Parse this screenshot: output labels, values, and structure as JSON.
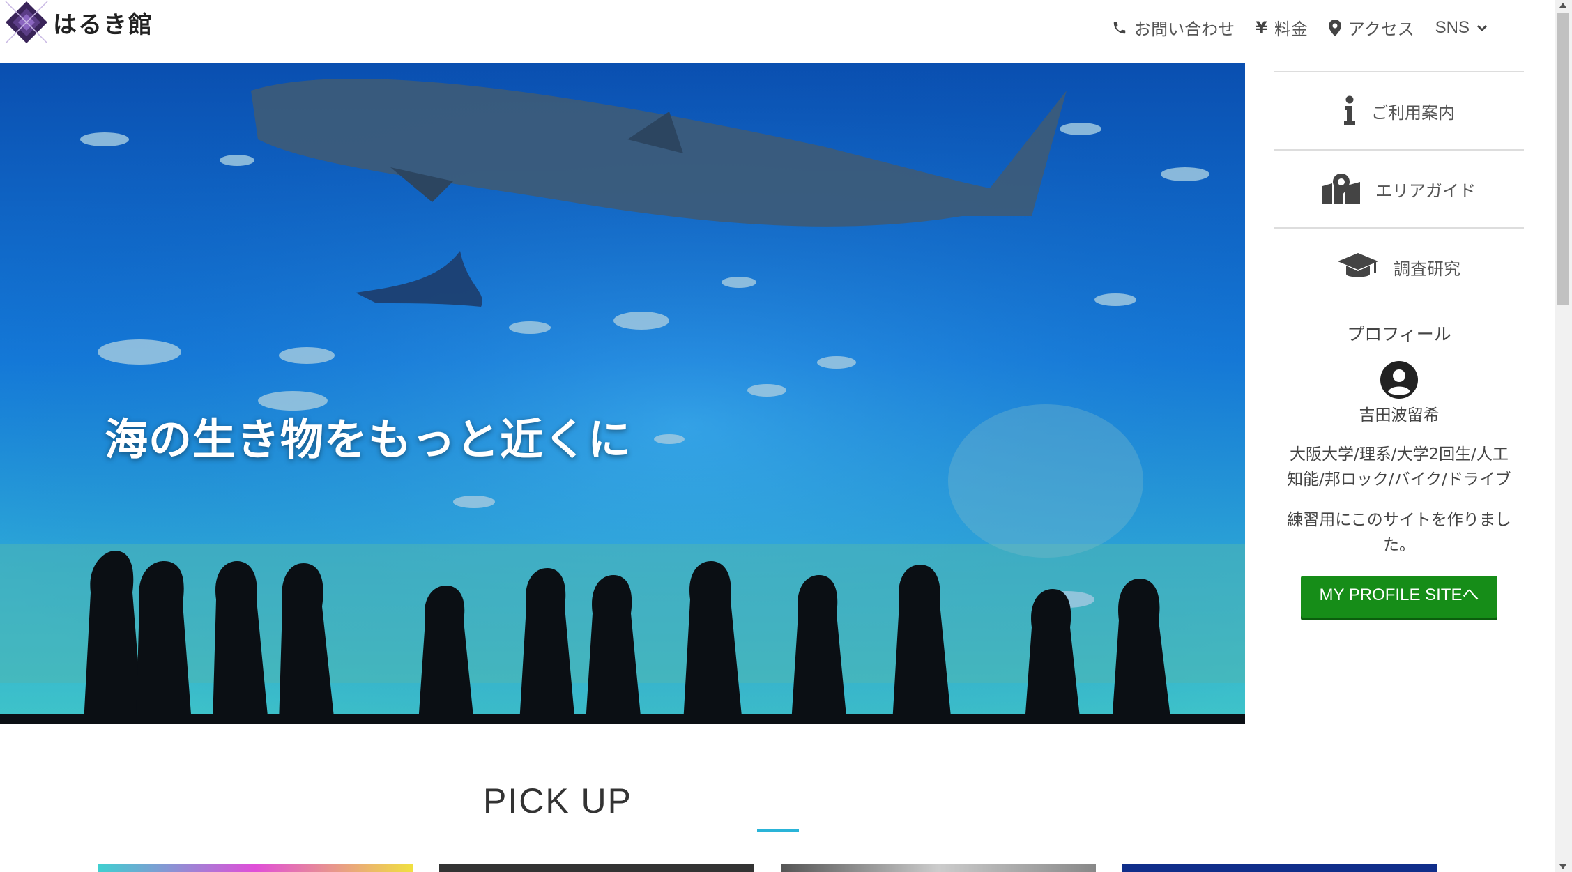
{
  "site": {
    "logo_text": "はるき館"
  },
  "nav": {
    "contact": {
      "label": "お問い合わせ",
      "icon": "phone-icon"
    },
    "price": {
      "label": "料金",
      "icon": "yen-icon"
    },
    "access": {
      "label": "アクセス",
      "icon": "map-pin-icon"
    },
    "sns": {
      "label": "SNS",
      "icon": "chevron-down-icon"
    }
  },
  "hero": {
    "headline": "海の生き物をもっと近くに"
  },
  "sidebar": {
    "links": [
      {
        "label": "ご利用案内",
        "icon": "info-icon"
      },
      {
        "label": "エリアガイド",
        "icon": "map-marker-icon"
      },
      {
        "label": "調査研究",
        "icon": "graduation-cap-icon"
      }
    ],
    "profile": {
      "title": "プロフィール",
      "name": "吉田波留希",
      "desc_line1": "大阪大学/理系/大学2回生/人工",
      "desc_line2": "知能/邦ロック/バイク/ドライブ",
      "note_line1": "練習用にこのサイトを作りまし",
      "note_line2": "た。",
      "button_label": "MY PROFILE SITEへ"
    }
  },
  "pickup": {
    "title": "PICK UP"
  },
  "colors": {
    "accent_green": "#168d18",
    "accent_cyan": "#2ab4d8",
    "logo_purple": "#3a2459"
  }
}
